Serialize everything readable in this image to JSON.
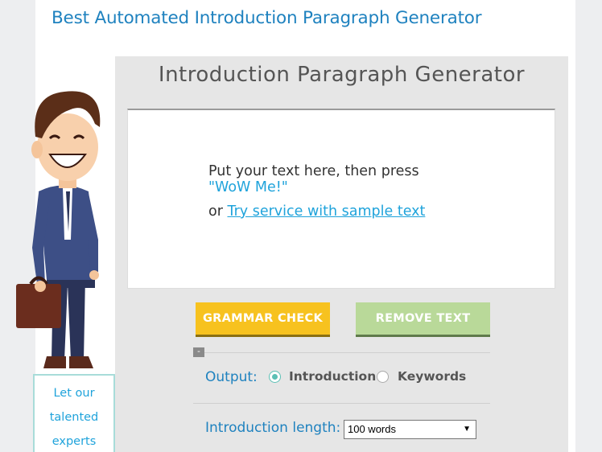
{
  "site": {
    "title": "Best Automated Introduction Paragraph Generator"
  },
  "panel": {
    "title": "Introduction Paragraph Generator"
  },
  "editor": {
    "placeholder_line1": "Put your text here, then press",
    "placeholder_line2": "\"WoW Me!\"",
    "or_text": "or ",
    "sample_link": "Try service with sample text"
  },
  "buttons": {
    "grammar_check": "GRAMMAR CHECK",
    "remove_text": "REMOVE TEXT"
  },
  "options": {
    "collapse": "-",
    "output_label": "Output:",
    "output_choices": [
      {
        "label": "Introduction",
        "selected": true
      },
      {
        "label": "Keywords",
        "selected": false
      }
    ],
    "length_label": "Introduction length:",
    "length_value": "100 words"
  },
  "promo": {
    "lines": [
      "Let our",
      "talented",
      "experts"
    ]
  },
  "colors": {
    "brand_blue": "#1f82bf",
    "link_blue": "#1fa3db",
    "grammar_yellow": "#f7c21f",
    "remove_green": "#b9d999"
  }
}
